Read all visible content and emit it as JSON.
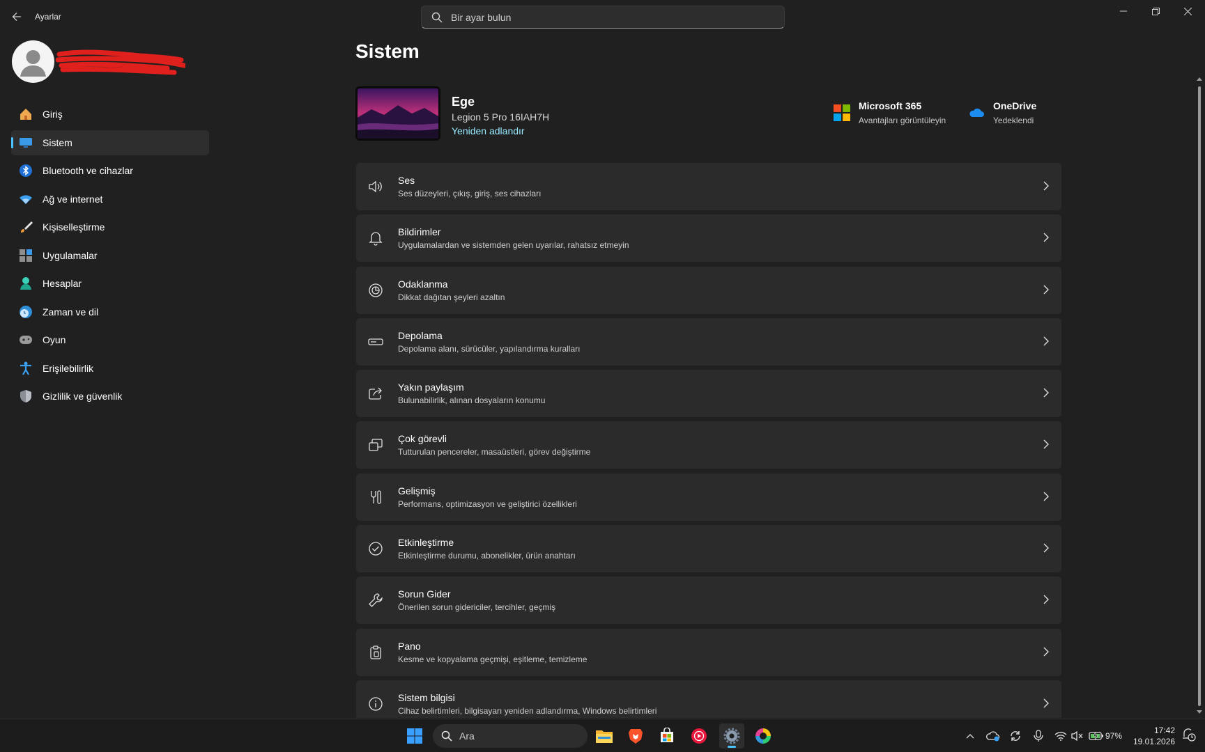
{
  "window": {
    "app_title": "Ayarlar",
    "search_placeholder": "Bir ayar bulun"
  },
  "sidebar": {
    "items": [
      {
        "label": "Giriş",
        "icon": "home-icon"
      },
      {
        "label": "Sistem",
        "icon": "monitor-icon",
        "active": true
      },
      {
        "label": "Bluetooth ve cihazlar",
        "icon": "bluetooth-icon"
      },
      {
        "label": "Ağ ve internet",
        "icon": "wifi-icon"
      },
      {
        "label": "Kişiselleştirme",
        "icon": "brush-icon"
      },
      {
        "label": "Uygulamalar",
        "icon": "apps-icon"
      },
      {
        "label": "Hesaplar",
        "icon": "person-icon"
      },
      {
        "label": "Zaman ve dil",
        "icon": "globe-clock-icon"
      },
      {
        "label": "Oyun",
        "icon": "gamepad-icon"
      },
      {
        "label": "Erişilebilirlik",
        "icon": "accessibility-icon"
      },
      {
        "label": "Gizlilik ve güvenlik",
        "icon": "shield-icon"
      }
    ]
  },
  "main": {
    "title": "Sistem",
    "device": {
      "name": "Ege",
      "model": "Legion 5 Pro 16IAH7H",
      "rename": "Yeniden adlandır"
    },
    "promos": [
      {
        "title": "Microsoft 365",
        "subtitle": "Avantajları görüntüleyin",
        "icon": "microsoft-logo-icon"
      },
      {
        "title": "OneDrive",
        "subtitle": "Yedeklendi",
        "icon": "onedrive-cloud-icon"
      }
    ],
    "cards": [
      {
        "title": "Ses",
        "subtitle": "Ses düzeyleri, çıkış, giriş, ses cihazları",
        "icon": "speaker-icon"
      },
      {
        "title": "Bildirimler",
        "subtitle": "Uygulamalardan ve sistemden gelen uyarılar, rahatsız etmeyin",
        "icon": "bell-icon"
      },
      {
        "title": "Odaklanma",
        "subtitle": "Dikkat dağıtan şeyleri azaltın",
        "icon": "focus-icon"
      },
      {
        "title": "Depolama",
        "subtitle": "Depolama alanı, sürücüler, yapılandırma kuralları",
        "icon": "storage-icon"
      },
      {
        "title": "Yakın paylaşım",
        "subtitle": "Bulunabilirlik, alınan dosyaların konumu",
        "icon": "share-icon"
      },
      {
        "title": "Çok görevli",
        "subtitle": "Tutturulan pencereler, masaüstleri, görev değiştirme",
        "icon": "multitask-icon"
      },
      {
        "title": "Gelişmiş",
        "subtitle": "Performans, optimizasyon ve geliştirici özellikleri",
        "icon": "tools-icon"
      },
      {
        "title": "Etkinleştirme",
        "subtitle": "Etkinleştirme durumu, abonelikler, ürün anahtarı",
        "icon": "check-circle-icon"
      },
      {
        "title": "Sorun Gider",
        "subtitle": "Önerilen sorun gidericiler, tercihler, geçmiş",
        "icon": "wrench-icon"
      },
      {
        "title": "Pano",
        "subtitle": "Kesme ve kopyalama geçmişi, eşitleme, temizleme",
        "icon": "clipboard-icon"
      },
      {
        "title": "Sistem bilgisi",
        "subtitle": "Cihaz belirtimleri, bilgisayarı yeniden adlandırma, Windows belirtimleri",
        "icon": "info-icon"
      }
    ]
  },
  "taskbar": {
    "search_label": "Ara",
    "battery": "97%",
    "time": "17:42",
    "date": "19.01.2026",
    "apps": [
      "start-icon",
      "file-explorer-icon",
      "brave-icon",
      "store-icon",
      "youtube-music-icon",
      "settings-icon",
      "color-app-icon"
    ]
  },
  "colors": {
    "background": "#202020",
    "card": "#2b2b2b",
    "accent": "#4cc2ff",
    "link": "#99ebff"
  }
}
